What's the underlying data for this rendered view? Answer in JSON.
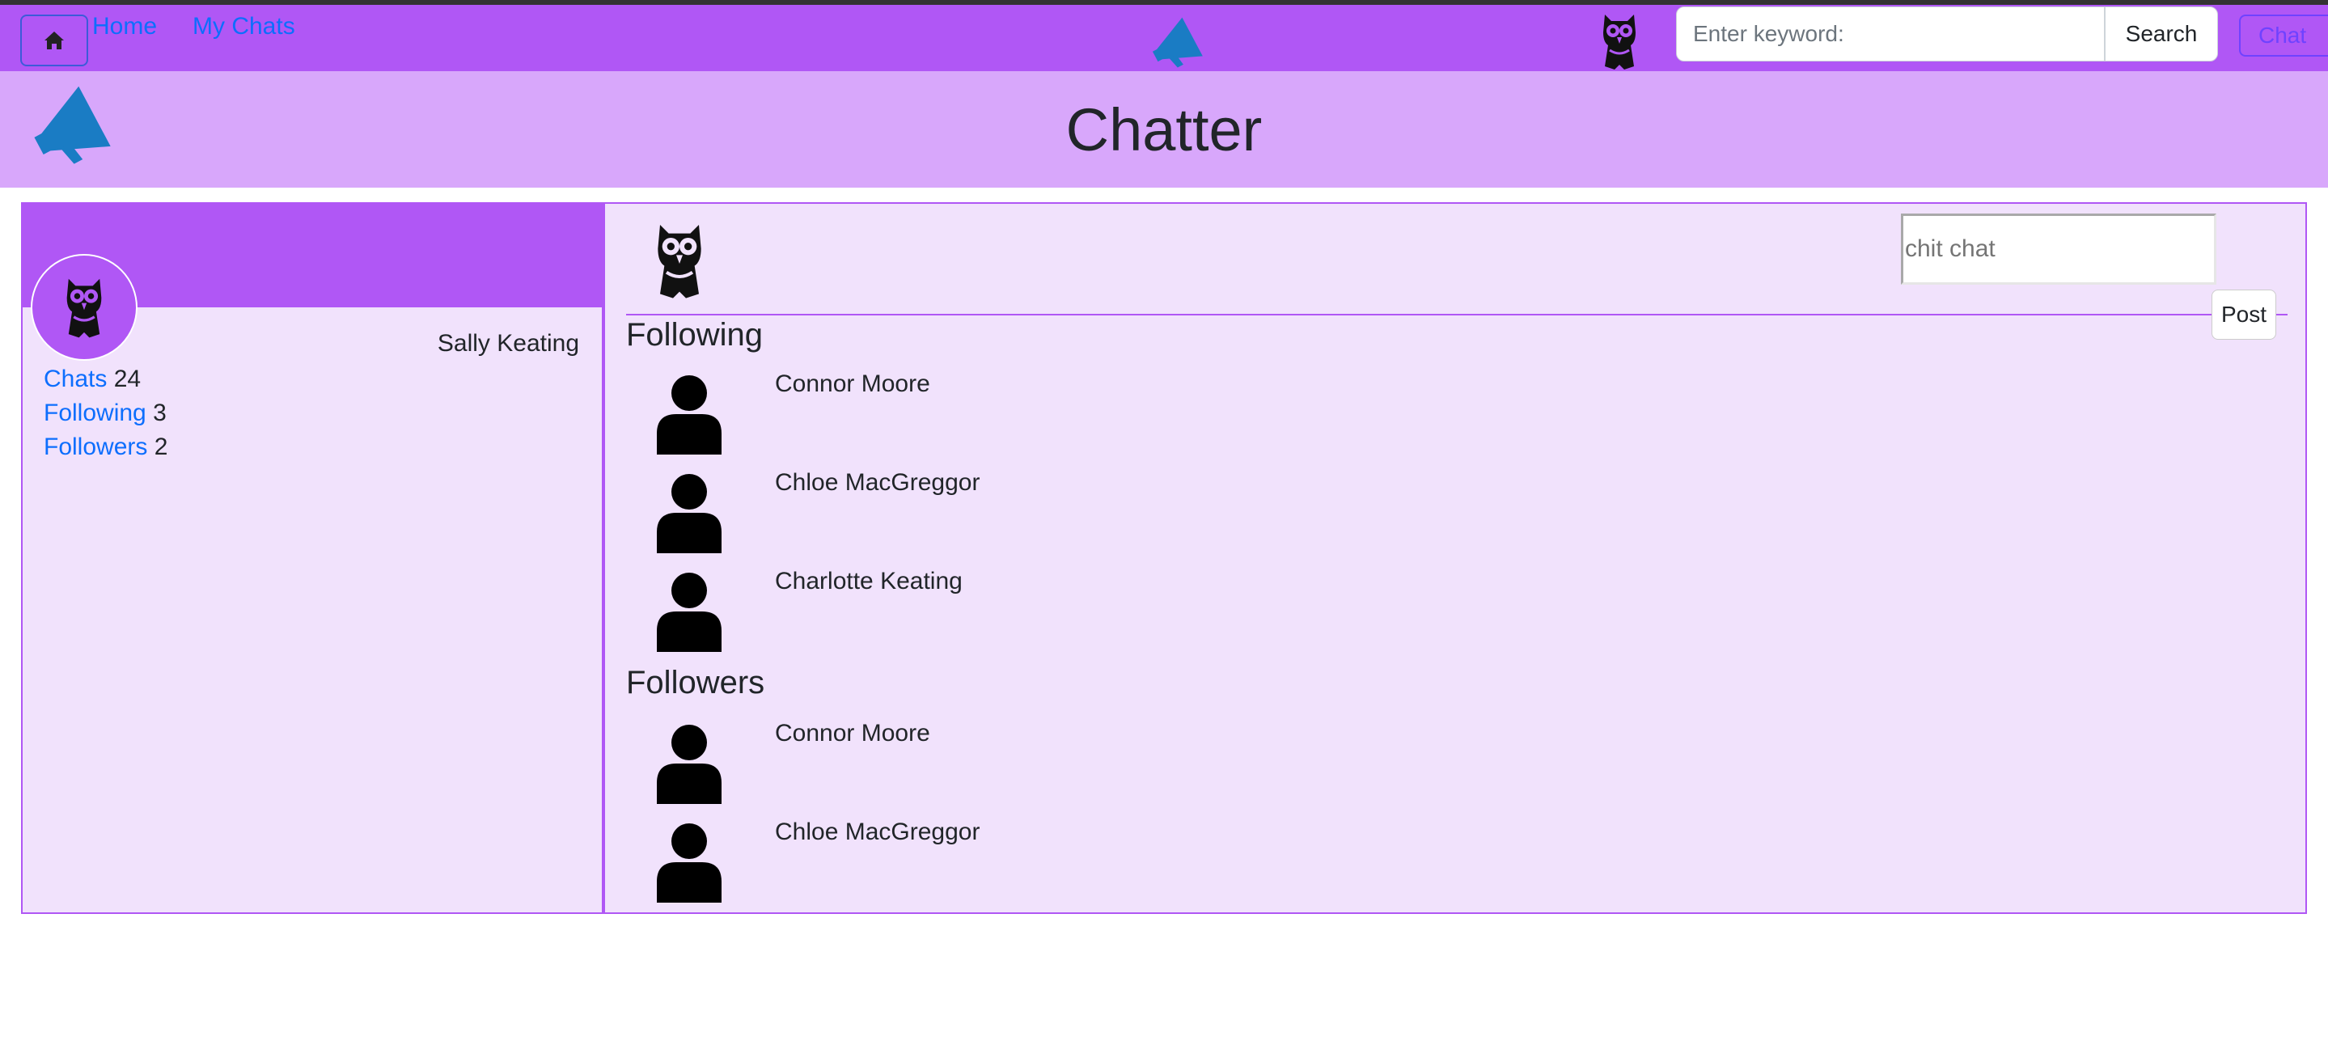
{
  "navbar": {
    "home_label": "Home",
    "mychats_label": "My Chats",
    "search_placeholder": "Enter keyword:",
    "search_button": "Search",
    "chat_button": "Chat",
    "bg_color": "#b057f5",
    "link_color": "#0d6efd"
  },
  "banner": {
    "title": "Chatter",
    "bg_color": "#d8a7fb",
    "logo_icon": "megaphone-icon"
  },
  "profile": {
    "name": "Sally Keating",
    "avatar_icon": "owl-icon",
    "stats": [
      {
        "label": "Chats",
        "value": "24"
      },
      {
        "label": "Following",
        "value": "3"
      },
      {
        "label": "Followers",
        "value": "2"
      }
    ]
  },
  "composer": {
    "placeholder": "chit chat",
    "post_button": "Post"
  },
  "following": {
    "title": "Following",
    "people": [
      "Connor Moore",
      "Chloe MacGreggor",
      "Charlotte Keating"
    ]
  },
  "followers": {
    "title": "Followers",
    "people": [
      "Connor Moore",
      "Chloe MacGreggor"
    ]
  }
}
